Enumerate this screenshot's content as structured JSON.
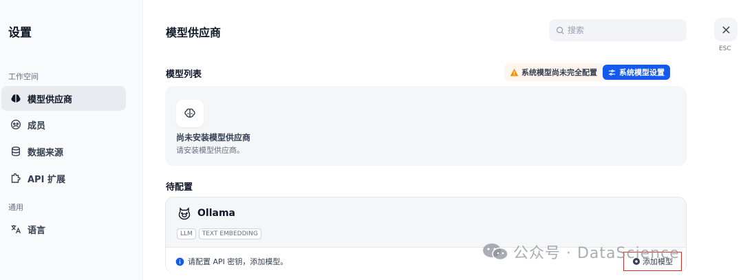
{
  "sidebar": {
    "title": "设置",
    "sections": [
      {
        "label": "工作空间"
      },
      {
        "label": "通用"
      }
    ],
    "items": [
      {
        "label": "模型供应商",
        "icon": "brain-icon",
        "active": true
      },
      {
        "label": "成员",
        "icon": "members-icon",
        "active": false
      },
      {
        "label": "数据来源",
        "icon": "database-icon",
        "active": false
      },
      {
        "label": "API 扩展",
        "icon": "puzzle-icon",
        "active": false
      },
      {
        "label": "语言",
        "icon": "translate-icon",
        "active": false
      }
    ]
  },
  "header": {
    "title": "模型供应商",
    "search_placeholder": "搜索",
    "close_label": "ESC"
  },
  "model_list": {
    "title": "模型列表",
    "warning": "系统模型尚未完全配置",
    "system_settings_button": "系统模型设置",
    "empty_title": "尚未安装模型供应商",
    "empty_desc": "请安装模型供应商。"
  },
  "pending": {
    "title": "待配置",
    "provider": {
      "name": "Ollama",
      "tags": [
        "LLM",
        "TEXT EMBEDDING"
      ],
      "notice": "请配置 API 密钥，添加模型。",
      "add_button": "添加模型"
    }
  },
  "watermark": {
    "text": "公众号 · DataScience"
  },
  "colors": {
    "primary": "#155aef",
    "warning": "#f79009",
    "info": "#155aef",
    "highlight_border": "#d92d20"
  }
}
